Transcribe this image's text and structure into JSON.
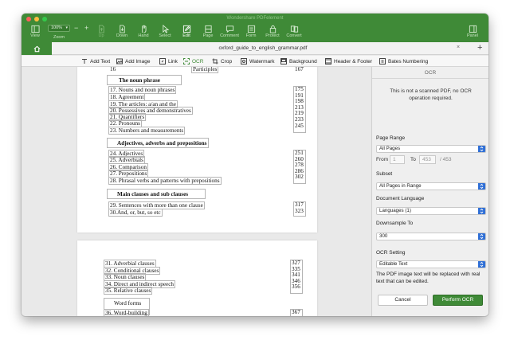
{
  "window": {
    "title": "Wondershare PDFelement"
  },
  "toolbar": {
    "zoom_value": "100%",
    "zoom_label": "Zoom",
    "items": [
      {
        "label": "View"
      },
      {
        "label": "Up"
      },
      {
        "label": "Down"
      },
      {
        "label": "Hand"
      },
      {
        "label": "Select"
      },
      {
        "label": "Edit"
      },
      {
        "label": "Page"
      },
      {
        "label": "Comment"
      },
      {
        "label": "Form"
      },
      {
        "label": "Protect"
      },
      {
        "label": "Convert"
      },
      {
        "label": "Panel"
      }
    ]
  },
  "tab": {
    "filename": "oxford_guide_to_english_grammar.pdf",
    "close": "×",
    "add": "+"
  },
  "edit_toolbar": {
    "add_text": "Add Text",
    "add_image": "Add Image",
    "link": "Link",
    "ocr": "OCR",
    "crop": "Crop",
    "watermark": "Watermark",
    "background": "Background",
    "header_footer": "Header & Footer",
    "bates": "Bates Numbering"
  },
  "document": {
    "page1": {
      "top_item": "16",
      "top_item_text": "Participles",
      "top_item_page": "167",
      "sections": [
        {
          "heading": "The noun phrase",
          "items": [
            {
              "label": "17. Nouns and noun phrases",
              "page": "175"
            },
            {
              "label": "18. Agreement",
              "page": "191"
            },
            {
              "label": "19. The articles: a/an and the",
              "page": "198"
            },
            {
              "label": "20. Possessives and demonstratives",
              "page": "213"
            },
            {
              "label": "21. Quantifiers",
              "page": "219"
            },
            {
              "label": "22. Pronouns",
              "page": "233"
            },
            {
              "label": "23. Numbers and measurements",
              "page": "245"
            }
          ]
        },
        {
          "heading": "Adjectives, adverbs and prepositions",
          "items": [
            {
              "label": "24. Adjectives",
              "page": "251"
            },
            {
              "label": "25. Adverbials",
              "page": "260"
            },
            {
              "label": "26. Comparison",
              "page": "278"
            },
            {
              "label": "27. Prepositions",
              "page": "286"
            },
            {
              "label": "28. Phrasal verbs and patterns with prepositions",
              "page": "302"
            }
          ]
        },
        {
          "heading": "Main clauses and sub clauses",
          "items": [
            {
              "label": "29. Sentences with more than one clause",
              "page": "317"
            },
            {
              "label": "30.And, or, but, so etc",
              "page": "323"
            }
          ]
        }
      ]
    },
    "page2": {
      "items": [
        {
          "label": "31. Adverbial clauses",
          "page": "327"
        },
        {
          "label": "32. Conditional clauses",
          "page": "335"
        },
        {
          "label": "33. Noun clauses",
          "page": "341"
        },
        {
          "label": "34. Direct and indirect speech",
          "page": "346"
        },
        {
          "label": "35. Relative clauses",
          "page": "356"
        }
      ],
      "heading": "Word forms",
      "heading_items": [
        {
          "label": "36. Word-building",
          "page": "367"
        }
      ]
    }
  },
  "ocr_panel": {
    "title": "OCR",
    "message": "This is not a scanned PDF, no OCR operation required.",
    "page_range_label": "Page Range",
    "page_range_value": "All Pages",
    "from_label": "From",
    "from_value": "1",
    "to_label": "To",
    "to_value": "453",
    "total": "/ 453",
    "subset_label": "Subset",
    "subset_value": "All Pages in Range",
    "language_label": "Document Language",
    "language_value": "Languages (1)",
    "downsample_label": "Downsample To",
    "downsample_value": "300",
    "ocr_setting_label": "OCR Setting",
    "ocr_setting_value": "Editable Text",
    "description": "The PDF image text will be replaced with real text that can be edited.",
    "cancel_label": "Cancel",
    "perform_label": "Perform OCR"
  },
  "colors": {
    "brand_green": "#3f8a37",
    "select_blue": "#2f6fd6"
  }
}
